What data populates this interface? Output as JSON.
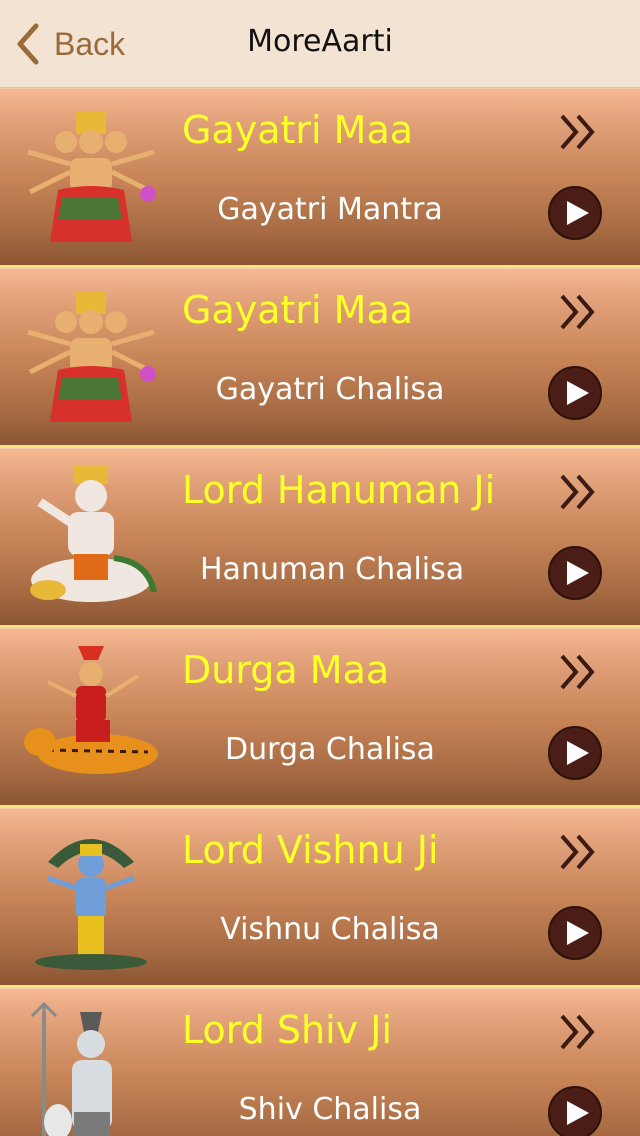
{
  "navbar": {
    "back_label": "Back",
    "title": "MoreAarti",
    "back_icon": "chevron-left-icon"
  },
  "colors": {
    "accent": "#9a6a3a",
    "deity_text": "#ffff2a",
    "song_text": "#ffffff",
    "row_top": "#f6b893",
    "row_bottom": "#8a5533",
    "separator": "#f5e27a",
    "play_button": "#4a1e16"
  },
  "rows": [
    {
      "deity": "Gayatri Maa",
      "song": "Gayatri Mantra",
      "image": "gayatri-image",
      "skin": "#e8b070",
      "robe": "#d8302a"
    },
    {
      "deity": "Gayatri Maa",
      "song": "Gayatri Chalisa",
      "image": "gayatri-image",
      "skin": "#e8b070",
      "robe": "#d8302a"
    },
    {
      "deity": "Lord Hanuman Ji",
      "song": "Hanuman Chalisa",
      "image": "hanuman-image",
      "skin": "#f0e8e0",
      "robe": "#e06a18"
    },
    {
      "deity": "Durga Maa",
      "song": "Durga Chalisa",
      "image": "durga-image",
      "skin": "#e8b070",
      "robe": "#c81e1e"
    },
    {
      "deity": "Lord Vishnu Ji",
      "song": "Vishnu Chalisa",
      "image": "vishnu-image",
      "skin": "#6f9ed8",
      "robe": "#e8c020"
    },
    {
      "deity": "Lord Shiv Ji",
      "song": "Shiv Chalisa",
      "image": "shiv-image",
      "skin": "#d8dde2",
      "robe": "#7a7a7a"
    }
  ],
  "icons": {
    "more": "double-chevron-right-icon",
    "play": "play-icon"
  }
}
